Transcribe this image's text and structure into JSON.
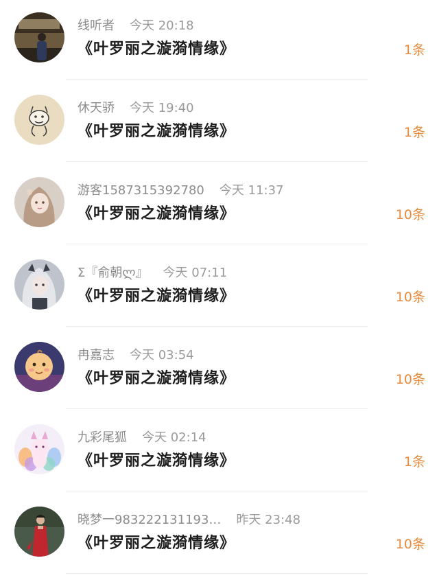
{
  "conversations": [
    {
      "name": "线听者",
      "time": "今天 20:18",
      "message": "《叶罗丽之漩漪情缘》",
      "count": "1条",
      "avatar": {
        "icon": "person-street-photo-avatar",
        "bg": "#6b5a3e",
        "fg": "#2f3a5a"
      }
    },
    {
      "name": "休天骄",
      "time": "今天 19:40",
      "message": "《叶罗丽之漩漪情缘》",
      "count": "1条",
      "avatar": {
        "icon": "cartoon-doodle-avatar",
        "bg": "#e9dcc0",
        "fg": "#3a3a3a"
      }
    },
    {
      "name": "游客1587315392780",
      "time": "今天 11:37",
      "message": "《叶罗丽之漩漪情缘》",
      "count": "10条",
      "avatar": {
        "icon": "anime-girl-avatar",
        "bg": "#d8cfc6",
        "fg": "#8a6d5c"
      }
    },
    {
      "name": "Σ『俞朝ლ』",
      "time": "今天 07:11",
      "message": "《叶罗丽之漩漪情缘》",
      "count": "10条",
      "avatar": {
        "icon": "anime-girl-silver-hair-avatar",
        "bg": "#bfc4cc",
        "fg": "#3a3f4a"
      }
    },
    {
      "name": "冉嘉志",
      "time": "今天 03:54",
      "message": "《叶罗丽之漩漪情缘》",
      "count": "10条",
      "avatar": {
        "icon": "cartoon-baby-avatar",
        "bg": "#3b3a6e",
        "fg": "#f6c98a"
      }
    },
    {
      "name": "九彩尾狐",
      "time": "今天 02:14",
      "message": "《叶罗丽之漩漪情缘》",
      "count": "1条",
      "avatar": {
        "icon": "nine-tailed-fox-avatar",
        "bg": "#f3eef8",
        "fg": "#e9a9d3"
      }
    },
    {
      "name": "晓梦一983222131193…",
      "time": "昨天 23:48",
      "message": "《叶罗丽之漩漪情缘》",
      "count": "10条",
      "avatar": {
        "icon": "woman-red-dress-avatar",
        "bg": "#4a5a4a",
        "fg": "#c0262e"
      }
    }
  ],
  "colors": {
    "count": "#e88a3c",
    "name": "#8c8c8c",
    "message": "#1e1e1e",
    "divider": "#ececec"
  }
}
